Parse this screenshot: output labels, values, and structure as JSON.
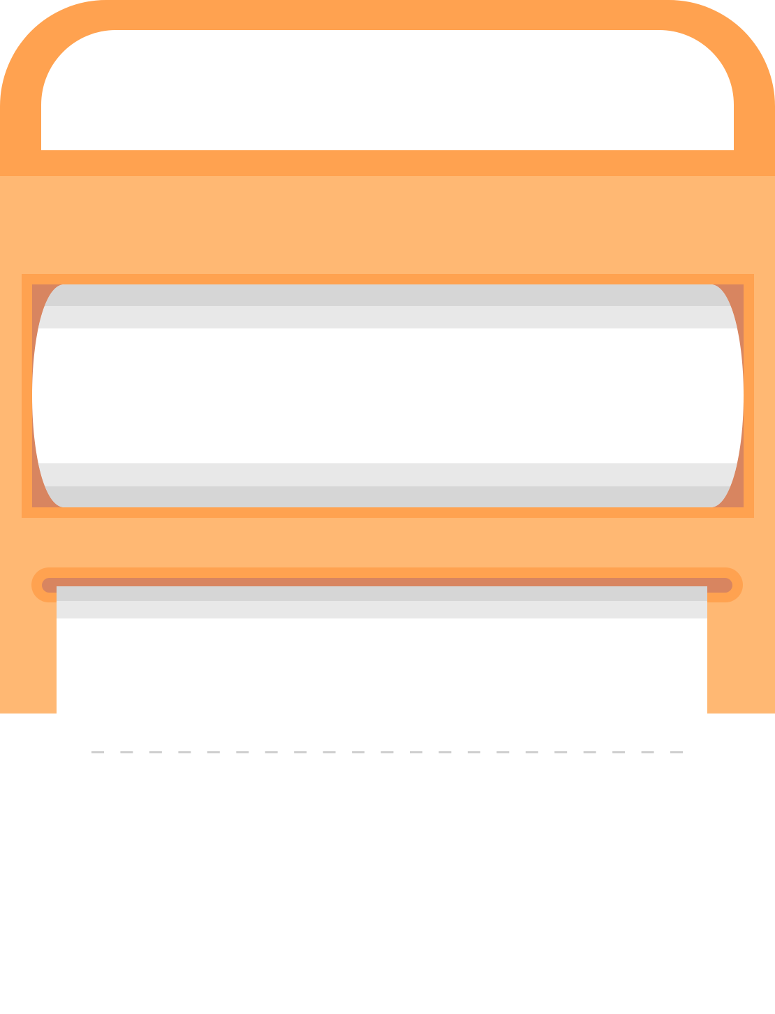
{
  "illustration": {
    "subject": "paper-roll-dispenser",
    "colors": {
      "handle": "#FFA250",
      "body": "#FFB873",
      "frame": "#FFA250",
      "slot_inner": "#D88560",
      "roll_shadow": "#D6D6D6",
      "roll_mid": "#E8E8E8",
      "paper": "#FFFFFF",
      "perforation": "#CFCFCF",
      "background": "#FFFFFF"
    },
    "perforation_dash_count": 21
  }
}
